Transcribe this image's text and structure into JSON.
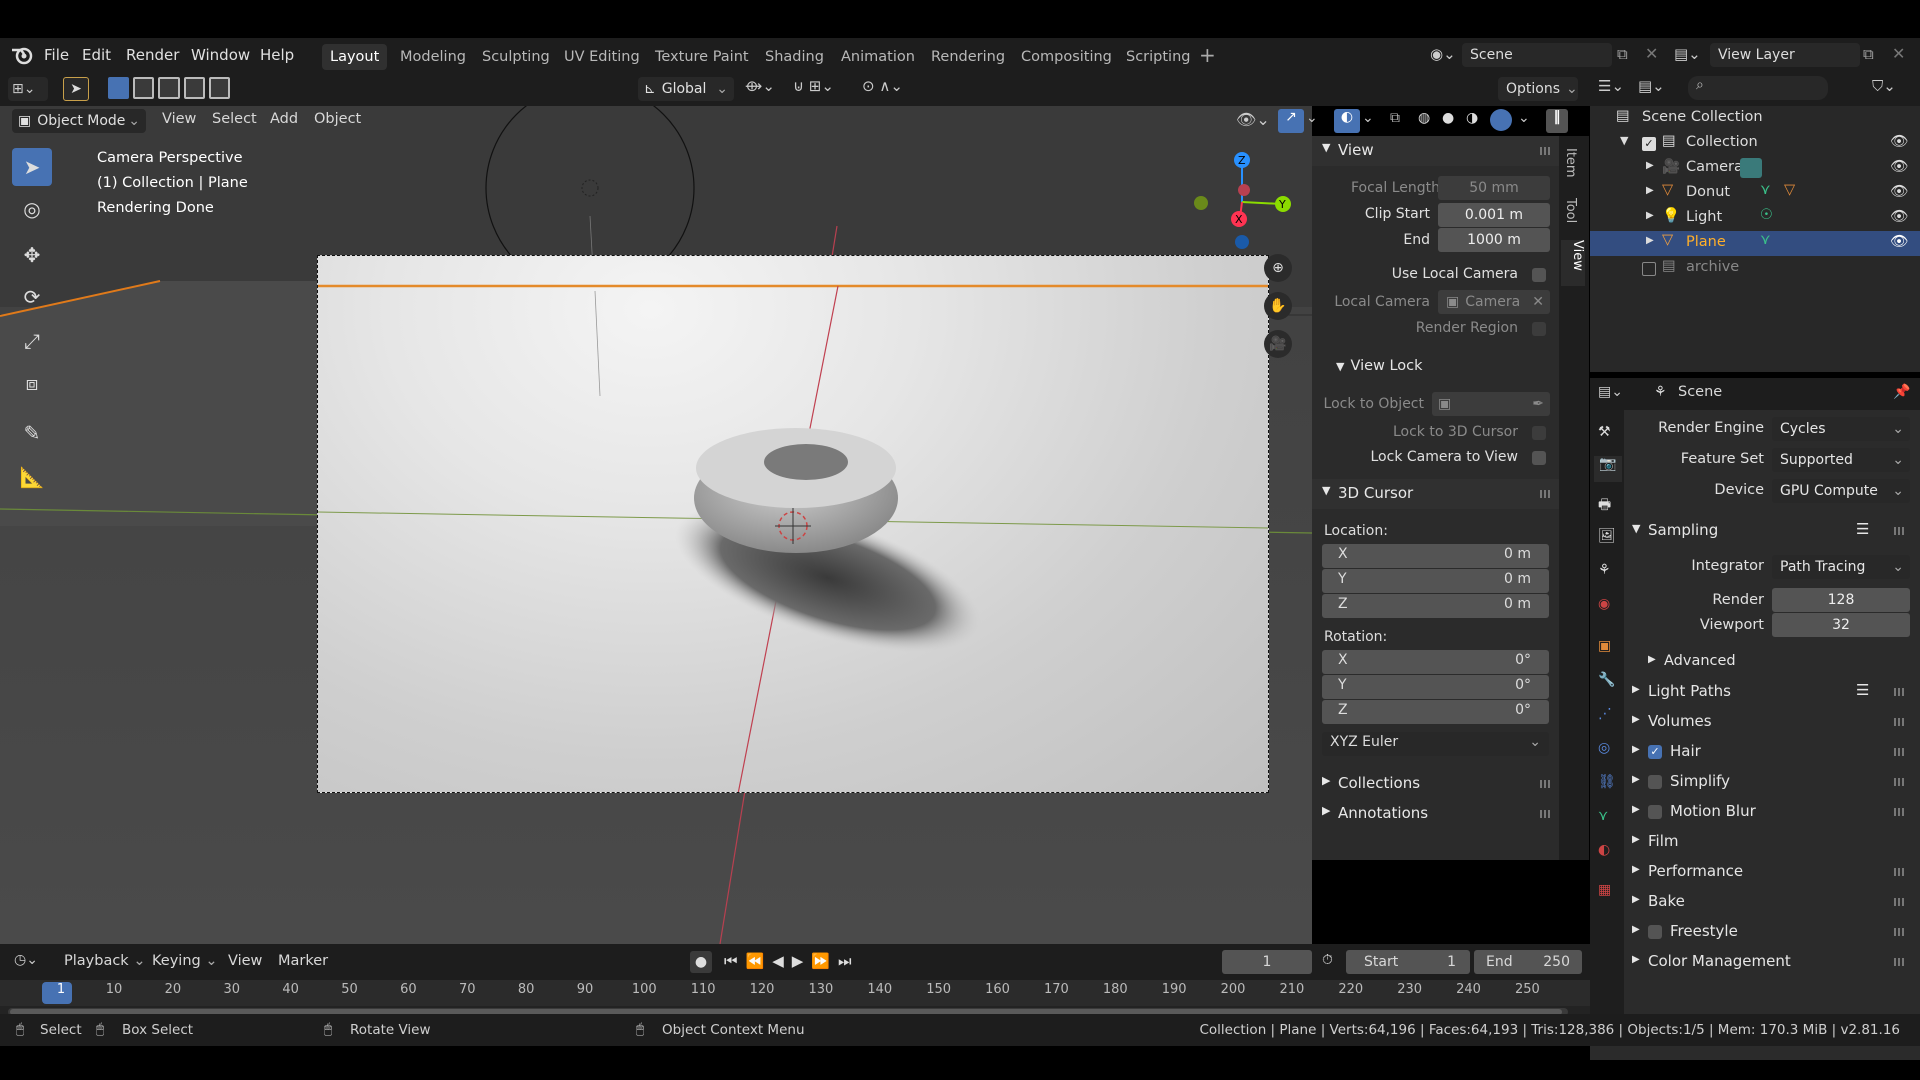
{
  "menu": {
    "file": "File",
    "edit": "Edit",
    "render": "Render",
    "window": "Window",
    "help": "Help"
  },
  "workspaces": [
    "Layout",
    "Modeling",
    "Sculpting",
    "UV Editing",
    "Texture Paint",
    "Shading",
    "Animation",
    "Rendering",
    "Compositing",
    "Scripting"
  ],
  "scene": {
    "name": "Scene",
    "view_layer": "View Layer"
  },
  "viewport": {
    "mode": "Object Mode",
    "menus": [
      "View",
      "Select",
      "Add",
      "Object"
    ],
    "orientation": "Global",
    "options": "Options",
    "overlay_lines": [
      "Camera Perspective",
      "(1) Collection | Plane",
      "Rendering Done"
    ]
  },
  "npanel": {
    "tabs": [
      "Item",
      "Tool",
      "View"
    ],
    "view": {
      "title": "View",
      "focal_length_label": "Focal Length",
      "focal_length": "50 mm",
      "clip_start_label": "Clip Start",
      "clip_start": "0.001 m",
      "end_label": "End",
      "end": "1000 m",
      "use_local_camera": "Use Local Camera",
      "local_camera_label": "Local Camera",
      "local_camera": "Camera",
      "render_region": "Render Region"
    },
    "view_lock": {
      "title": "View Lock",
      "lock_to_object": "Lock to Object",
      "lock_to_3d_cursor": "Lock to 3D Cursor",
      "lock_camera_to_view": "Lock Camera to View"
    },
    "cursor": {
      "title": "3D Cursor",
      "location": "Location:",
      "loc": [
        {
          "axis": "X",
          "value": "0 m"
        },
        {
          "axis": "Y",
          "value": "0 m"
        },
        {
          "axis": "Z",
          "value": "0 m"
        }
      ],
      "rotation": "Rotation:",
      "rot": [
        {
          "axis": "X",
          "value": "0°"
        },
        {
          "axis": "Y",
          "value": "0°"
        },
        {
          "axis": "Z",
          "value": "0°"
        }
      ],
      "rotation_mode": "XYZ Euler"
    },
    "collections": "Collections",
    "annotations": "Annotations"
  },
  "outliner": {
    "root": "Scene Collection",
    "items": [
      {
        "name": "Collection"
      },
      {
        "name": "Camera"
      },
      {
        "name": "Donut"
      },
      {
        "name": "Light"
      },
      {
        "name": "Plane"
      },
      {
        "name": "archive"
      }
    ]
  },
  "properties": {
    "header": "Scene",
    "render_engine_label": "Render Engine",
    "render_engine": "Cycles",
    "feature_set_label": "Feature Set",
    "feature_set": "Supported",
    "device_label": "Device",
    "device": "GPU Compute",
    "sampling": "Sampling",
    "integrator_label": "Integrator",
    "integrator": "Path Tracing",
    "render_label": "Render",
    "render_samples": "128",
    "viewport_label": "Viewport",
    "viewport_samples": "32",
    "advanced": "Advanced",
    "sections": [
      "Light Paths",
      "Volumes",
      "Hair",
      "Simplify",
      "Motion Blur",
      "Film",
      "Performance",
      "Bake",
      "Freestyle",
      "Color Management"
    ],
    "hair_checked": true
  },
  "timeline": {
    "menus": [
      "Playback",
      "Keying",
      "View",
      "Marker"
    ],
    "current_frame": "1",
    "start_label": "Start",
    "start": "1",
    "end_label": "End",
    "end": "250",
    "ticks": [
      "1",
      "10",
      "20",
      "30",
      "40",
      "50",
      "60",
      "70",
      "80",
      "90",
      "100",
      "110",
      "120",
      "130",
      "140",
      "150",
      "160",
      "170",
      "180",
      "190",
      "200",
      "210",
      "220",
      "230",
      "240",
      "250"
    ]
  },
  "status": {
    "select": "Select",
    "box_select": "Box Select",
    "rotate_view": "Rotate View",
    "context_menu": "Object Context Menu",
    "stats": "Collection | Plane | Verts:64,196 | Faces:64,193 | Tris:128,386 | Objects:1/5 | Mem: 170.3 MiB | v2.81.16"
  },
  "colors": {
    "accent": "#4772b3",
    "selected": "#ff8c1a",
    "axis_x": "#ff3352",
    "axis_y": "#8bdc00",
    "axis_z": "#2890ff"
  }
}
